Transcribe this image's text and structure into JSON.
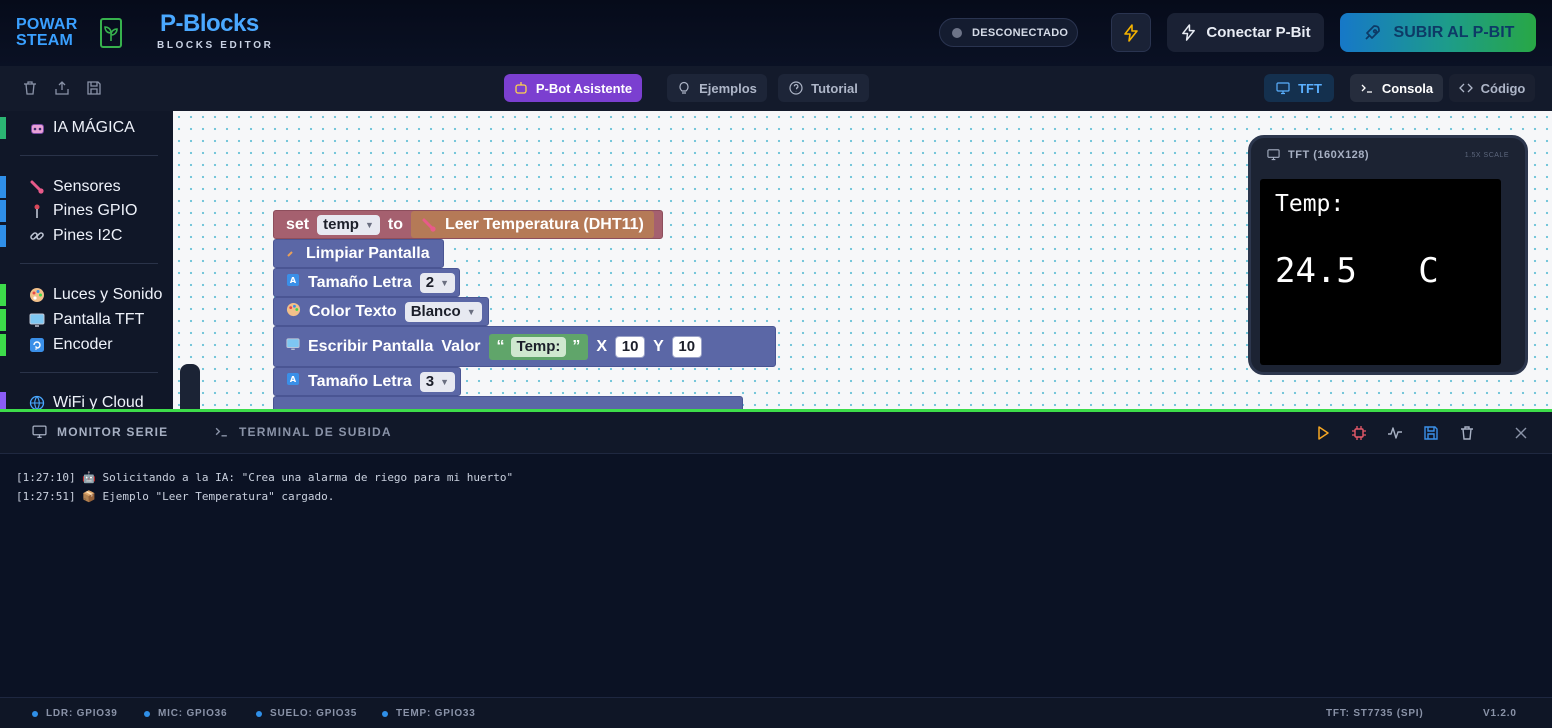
{
  "header": {
    "logo_line1": "POWAR",
    "logo_line2": "STEAM",
    "title": "P-Blocks",
    "subtitle": "BLOCKS EDITOR",
    "status": "DESCONECTADO",
    "connect_label": "Conectar P-Bit",
    "upload_label": "SUBIR AL P-BIT"
  },
  "toolbar": {
    "assistant": "P-Bot Asistente",
    "examples": "Ejemplos",
    "tutorial": "Tutorial",
    "tft": "TFT",
    "console": "Consola",
    "code": "Código"
  },
  "sidebar": {
    "categories": [
      {
        "label": "IA MÁGICA",
        "color": "#2bb673",
        "icon": "robot-icon"
      },
      {
        "label": "Sensores",
        "color": "#2f8fe8",
        "icon": "thermometer-icon"
      },
      {
        "label": "Pines GPIO",
        "color": "#2f8fe8",
        "icon": "pin-icon"
      },
      {
        "label": "Pines I2C",
        "color": "#2f8fe8",
        "icon": "link-icon"
      },
      {
        "label": "Luces y Sonido",
        "color": "#3ddc4a",
        "icon": "palette-icon"
      },
      {
        "label": "Pantalla TFT",
        "color": "#3ddc4a",
        "icon": "monitor-icon"
      },
      {
        "label": "Encoder",
        "color": "#3ddc4a",
        "icon": "encoder-icon"
      },
      {
        "label": "WiFi y Cloud",
        "color": "#8b5cf6",
        "icon": "globe-icon"
      }
    ]
  },
  "blocks": {
    "set_kw": "set",
    "var": "temp",
    "to_kw": "to",
    "read_temp": "Leer Temperatura (DHT11)",
    "clear": "Limpiar Pantalla",
    "font_size": "Tamaño Letra",
    "font_size_val1": "2",
    "color_text": "Color Texto",
    "color_val": "Blanco",
    "write": "Escribir Pantalla",
    "value_kw": "Valor",
    "string_val": "Temp:",
    "x_kw": "X",
    "x_val": "10",
    "y_kw": "Y",
    "y_val": "10",
    "font_size_val2": "3"
  },
  "tft": {
    "header": "TFT (160X128)",
    "scale": "1.5X SCALE",
    "line1": "Temp:",
    "line2": "24.5   C"
  },
  "bottom": {
    "tab_monitor": "MONITOR SERIE",
    "tab_terminal": "TERMINAL DE SUBIDA",
    "logs": [
      "[1:27:10] 🤖 Solicitando a la IA: \"Crea una alarma de riego para mi huerto\"",
      "[1:27:51] 📦 Ejemplo \"Leer Temperatura\" cargado."
    ]
  },
  "statusbar": {
    "pins": [
      "LDR: GPIO39",
      "MIC: GPIO36",
      "SUELO: GPIO35",
      "TEMP: GPIO33"
    ],
    "tft_driver": "TFT: ST7735 (SPI)",
    "version": "V1.2.0"
  }
}
